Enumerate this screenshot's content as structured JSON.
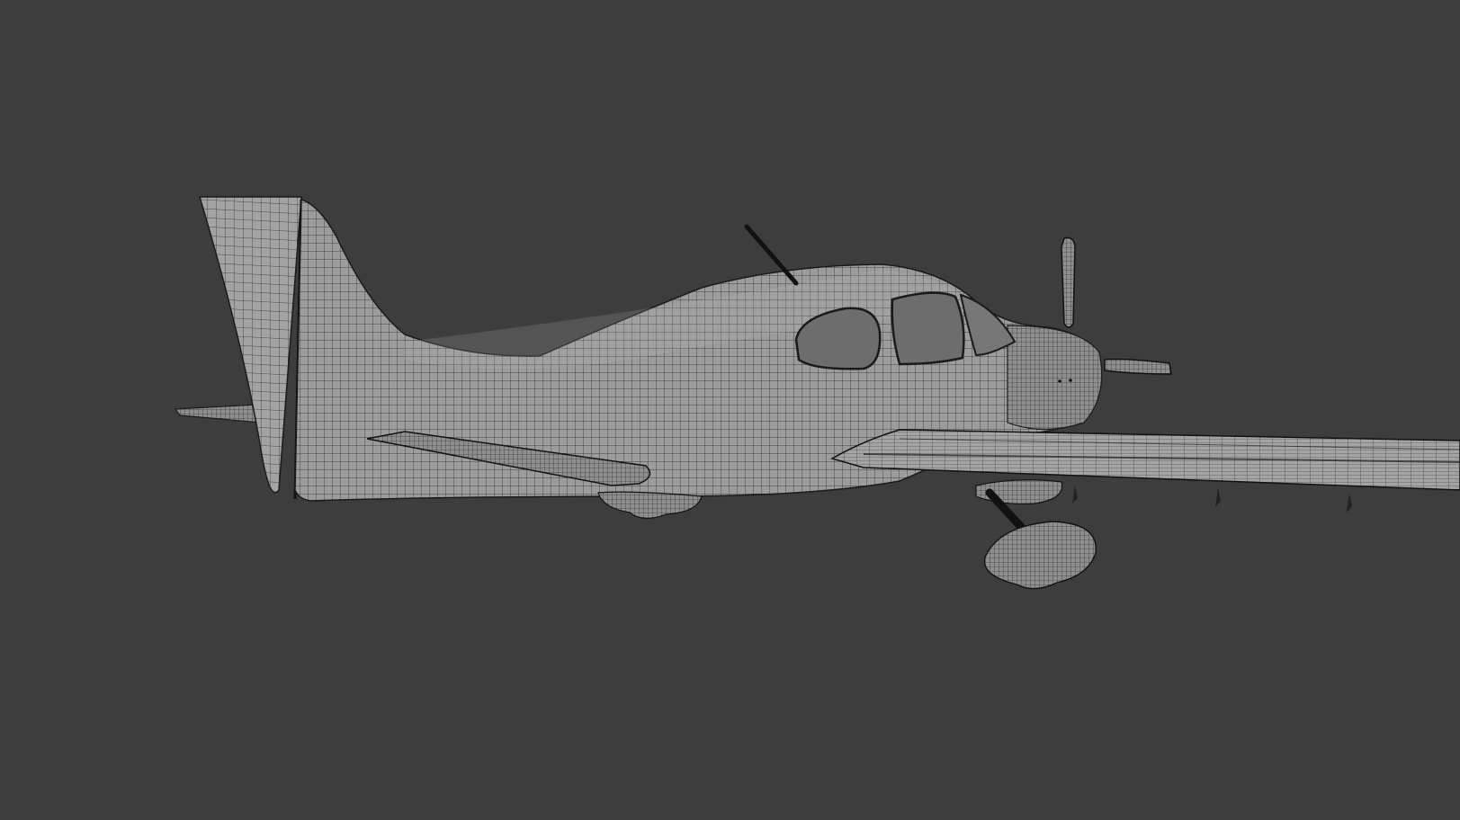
{
  "viewport": {
    "background": "#3d3d3d",
    "mode": "wireframe-on-shaded",
    "model": "single-engine-low-wing-airplane"
  },
  "colors": {
    "surface": "#9a9a9a",
    "surface_light": "#a8a8a8",
    "surface_dark": "#7f7f7f",
    "wire": "#1e1e1e",
    "glass": "#6d6d6d"
  }
}
